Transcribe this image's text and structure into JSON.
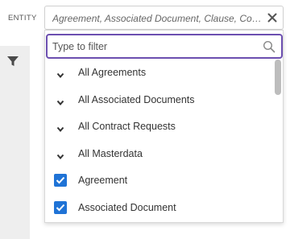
{
  "entity_field": {
    "label": "ENTITY",
    "value": "Agreement, Associated Document, Clause, Contract Request",
    "clear_icon": "close-icon"
  },
  "sidebar": {
    "filter_icon": "funnel-icon"
  },
  "dropdown": {
    "filter": {
      "placeholder": "Type to filter",
      "value": "",
      "icon": "search-icon"
    },
    "options": [
      {
        "label": "All Agreements",
        "kind": "group",
        "icon": "chevron-down-icon"
      },
      {
        "label": "All Associated Documents",
        "kind": "group",
        "icon": "chevron-down-icon"
      },
      {
        "label": "All Contract Requests",
        "kind": "group",
        "icon": "chevron-down-icon"
      },
      {
        "label": "All Masterdata",
        "kind": "group",
        "icon": "chevron-down-icon"
      },
      {
        "label": "Agreement",
        "kind": "checkbox",
        "checked": true
      },
      {
        "label": "Associated Document",
        "kind": "checkbox",
        "checked": true
      }
    ]
  },
  "colors": {
    "accent": "#6c4fb0",
    "checkbox": "#1f73d6",
    "sidebar": "#eeeeee"
  }
}
